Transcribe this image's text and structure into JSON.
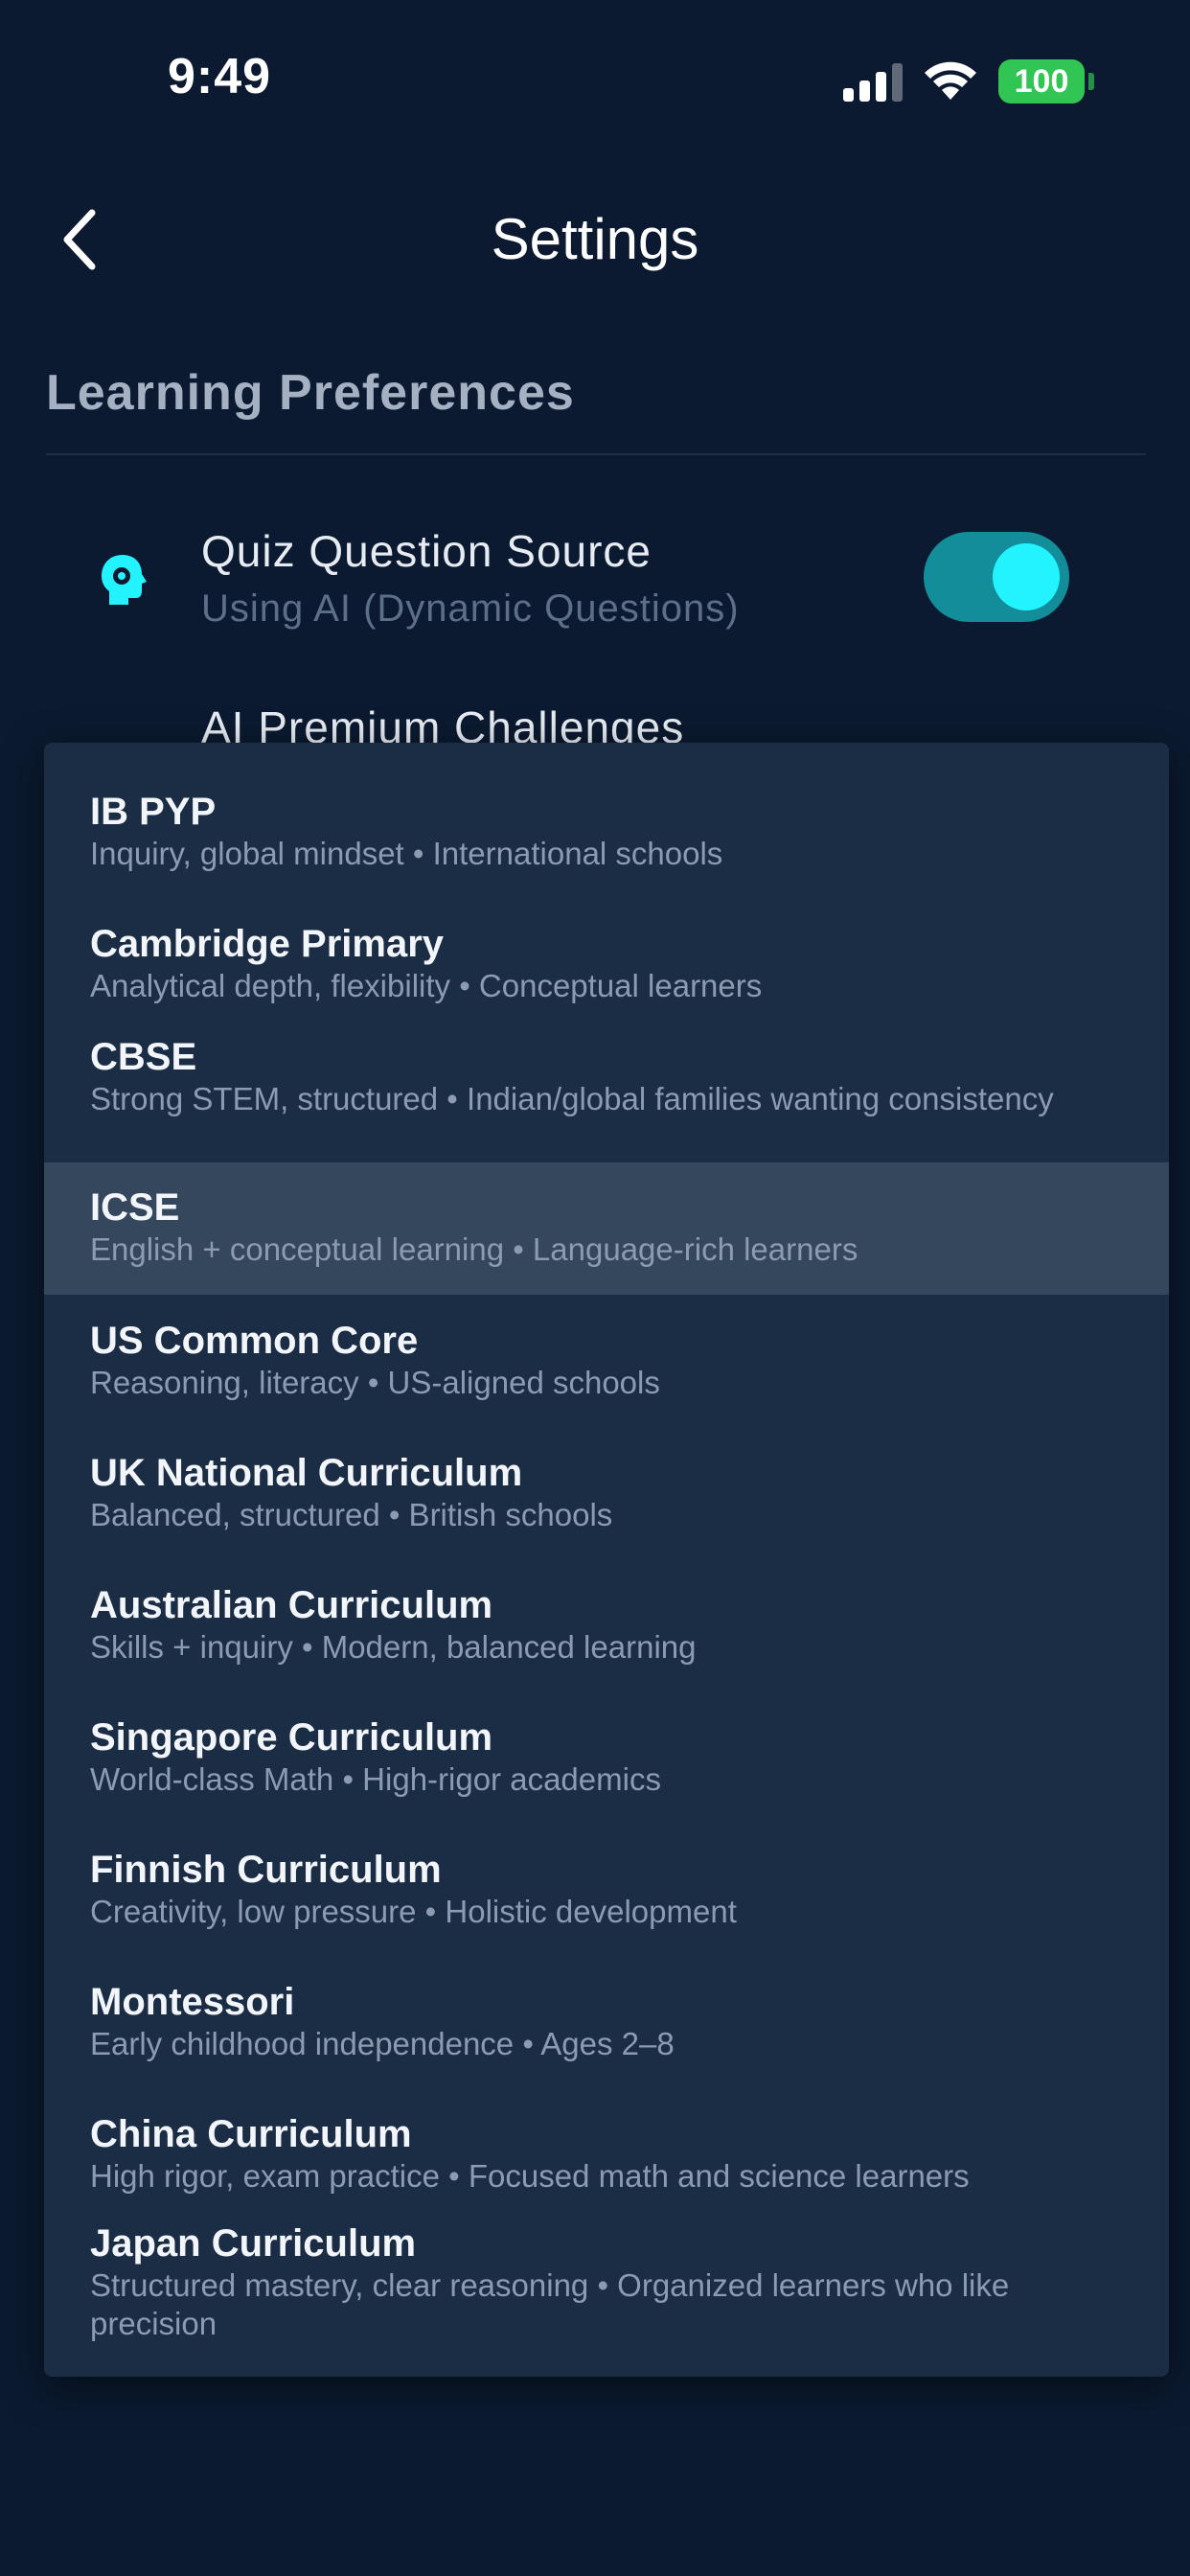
{
  "status_bar": {
    "time": "9:49",
    "battery": "100"
  },
  "header": {
    "title": "Settings"
  },
  "section": {
    "title": "Learning Preferences"
  },
  "quiz_source": {
    "title": "Quiz Question Source",
    "subtitle": "Using AI (Dynamic Questions)",
    "toggle_on": true,
    "icon": "ai-head-gear-icon"
  },
  "ai_challenges": {
    "title": "AI Premium Challenges"
  },
  "curriculum_options": [
    {
      "title": "IB PYP",
      "subtitle": "Inquiry, global mindset • International schools",
      "selected": false
    },
    {
      "title": "Cambridge Primary",
      "subtitle": "Analytical depth, flexibility • Conceptual learners",
      "selected": false
    },
    {
      "title": "CBSE",
      "subtitle": "Strong STEM, structured • Indian/global families wanting consistency",
      "selected": false
    },
    {
      "title": "ICSE",
      "subtitle": "English + conceptual learning • Language-rich learners",
      "selected": true
    },
    {
      "title": "US Common Core",
      "subtitle": "Reasoning, literacy • US-aligned schools",
      "selected": false
    },
    {
      "title": "UK National Curriculum",
      "subtitle": "Balanced, structured • British schools",
      "selected": false
    },
    {
      "title": "Australian Curriculum",
      "subtitle": "Skills + inquiry • Modern, balanced learning",
      "selected": false
    },
    {
      "title": "Singapore Curriculum",
      "subtitle": "World-class Math • High-rigor academics",
      "selected": false
    },
    {
      "title": "Finnish Curriculum",
      "subtitle": "Creativity, low pressure • Holistic development",
      "selected": false
    },
    {
      "title": "Montessori",
      "subtitle": "Early childhood independence • Ages 2–8",
      "selected": false
    },
    {
      "title": "China Curriculum",
      "subtitle": "High rigor, exam practice • Focused math and science learners",
      "selected": false
    },
    {
      "title": "Japan Curriculum",
      "subtitle": "Structured mastery, clear reasoning • Organized learners who like precision",
      "selected": false
    }
  ],
  "colors": {
    "background": "#0b1a30",
    "accent": "#23f3ff",
    "dropdown": "#1b2c45",
    "selected_row": "#35475d"
  }
}
